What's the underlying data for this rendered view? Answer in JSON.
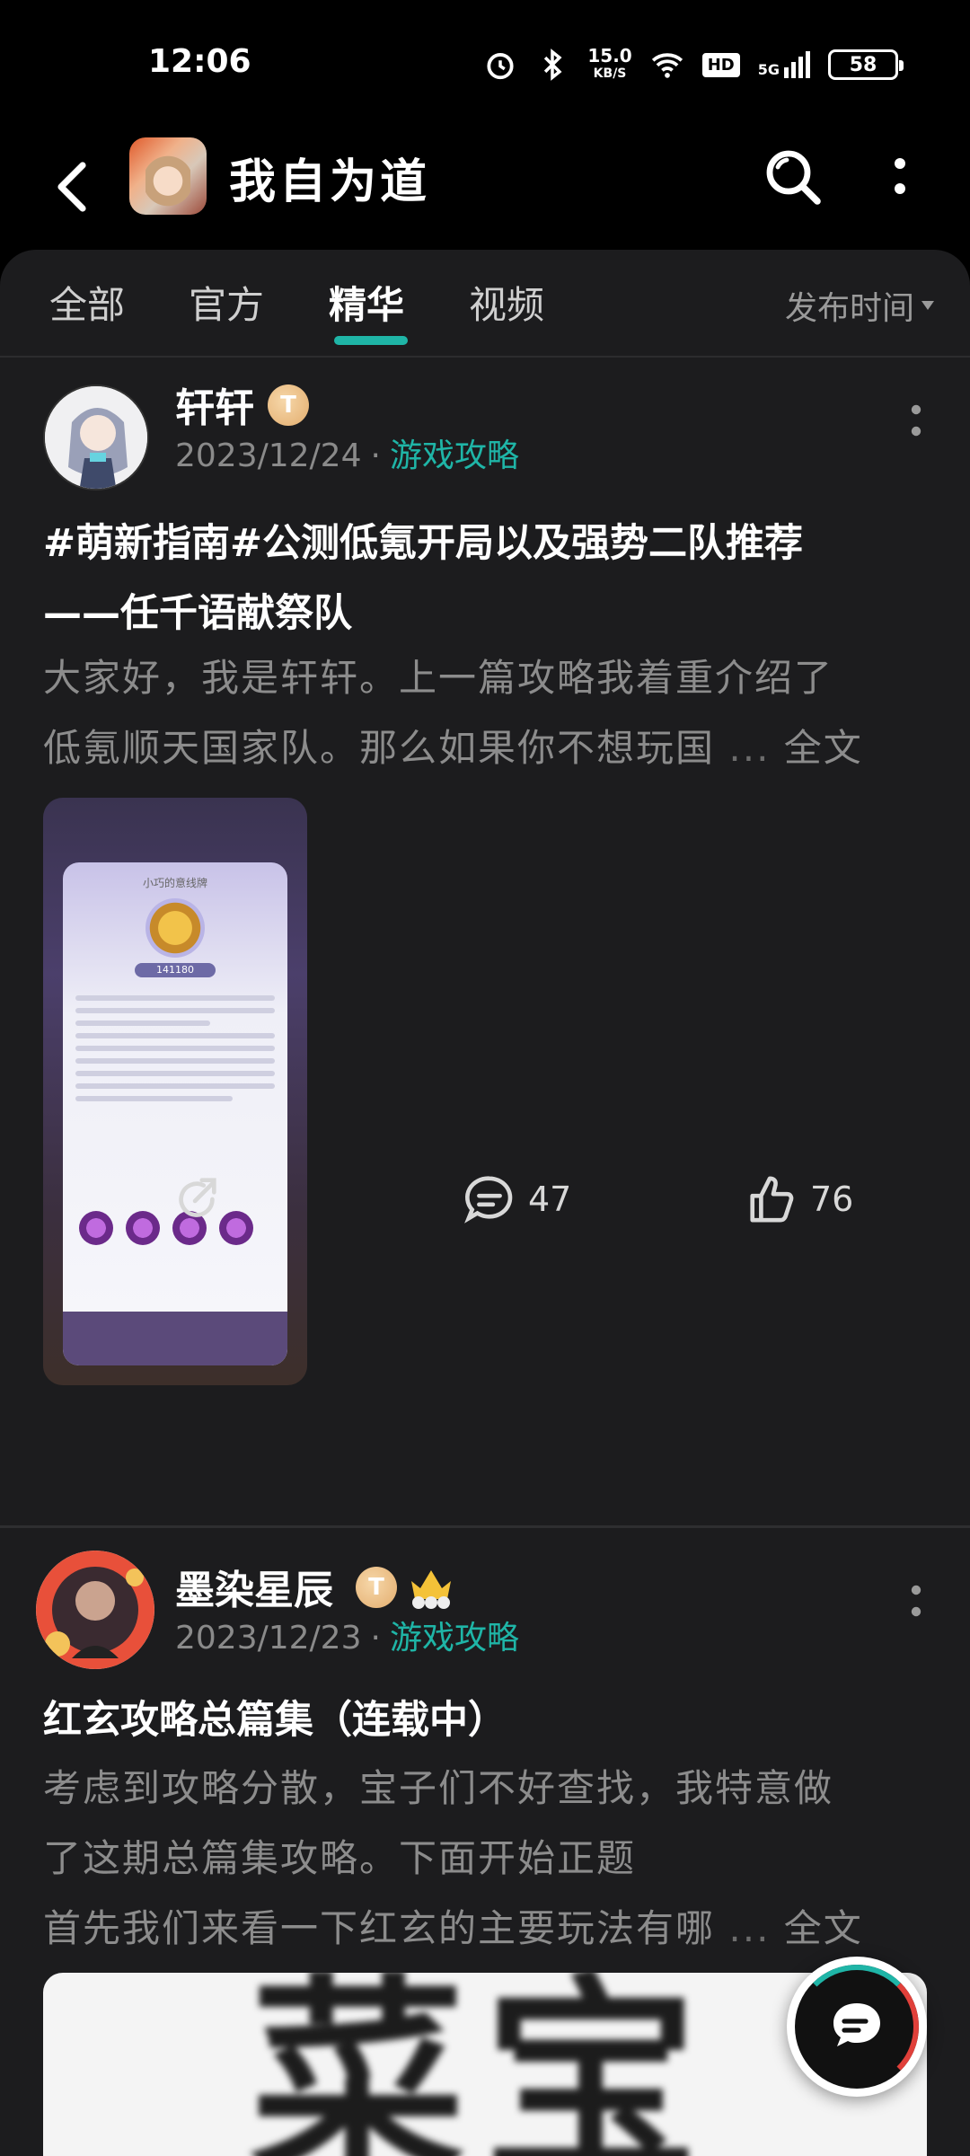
{
  "status_bar": {
    "time": "12:06",
    "speed_value": "15.0",
    "speed_unit": "KB/S",
    "hd_label": "HD",
    "network_label": "5G",
    "battery": "58"
  },
  "header": {
    "title": "我自为道",
    "back_icon": "back-arrow-icon",
    "search_icon": "search-icon",
    "more_icon": "more-vertical-icon"
  },
  "tabs": {
    "items": [
      "全部",
      "官方",
      "精华",
      "视频"
    ],
    "active_index": 2,
    "sort_label": "发布时间"
  },
  "posts": [
    {
      "author": "轩轩",
      "badge": "T",
      "date": "2023/12/24",
      "dot": "·",
      "category": "游戏攻略",
      "title_line1": "#萌新指南#公测低氪开局以及强势二队推荐",
      "title_line2": "——任千语献祭队",
      "excerpt_line1": "大家好，我是轩轩。上一篇攻略我着重介绍了",
      "excerpt_line2": "低氪顺天国家队。那么如果你不想玩国",
      "ellipsis": "...",
      "more_label": "全文",
      "image_caption": "小巧的意线牌",
      "image_value": "141180",
      "comments": "47",
      "likes": "76"
    },
    {
      "author": "墨染星辰",
      "badge": "T",
      "date": "2023/12/23",
      "dot": "·",
      "category": "游戏攻略",
      "title_line1": "红玄攻略总篇集（连载中）",
      "excerpt_line1": "考虑到攻略分散，宝子们不好查找，我特意做",
      "excerpt_line2": "了这期总篇集攻略。下面开始正题",
      "excerpt_line3": "首先我们来看一下红玄的主要玩法有哪",
      "ellipsis": "...",
      "more_label": "全文",
      "image_text": "菜宝"
    }
  ],
  "colors": {
    "accent": "#1fb5a7",
    "background": "#000000",
    "panel": "#1c1c1e",
    "muted_text": "#8c8c8c"
  }
}
